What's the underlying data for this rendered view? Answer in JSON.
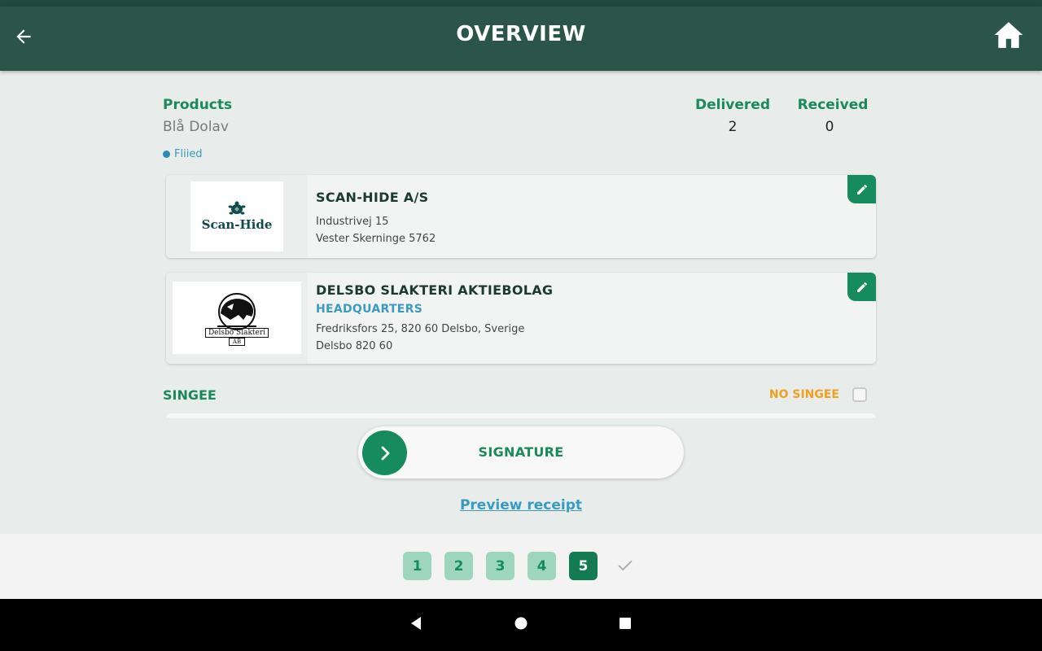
{
  "header": {
    "title": "OVERVIEW"
  },
  "summary": {
    "products_label": "Products",
    "products_value": "Blå Dolav",
    "status_label": "Fliied",
    "delivered_label": "Delivered",
    "delivered_value": "2",
    "received_label": "Received",
    "received_value": "0"
  },
  "cards": [
    {
      "logo_text": "Scan-Hide",
      "name": "SCAN-HIDE A/S",
      "address_line1": "Industrivej 15",
      "address_line2": "Vester Skerninge 5762"
    },
    {
      "logo_text": "Delsbo Slakteri",
      "logo_subtext": "AB",
      "name": "DELSBO SLAKTERI AKTIEBOLAG",
      "subtitle": "HEADQUARTERS",
      "address_line1": "Fredriksfors 25, 820 60 Delsbo, Sverige",
      "address_line2": "Delsbo 820 60"
    }
  ],
  "singee": {
    "label": "SINGEE",
    "no_singee_label": "NO SINGEE",
    "no_singee_checked": false
  },
  "signature": {
    "label": "SIGNATURE"
  },
  "preview_link": "Preview receipt",
  "steps": {
    "items": [
      "1",
      "2",
      "3",
      "4",
      "5"
    ],
    "active": "5"
  },
  "colors": {
    "header": "#2a5548",
    "accent": "#158b5e",
    "link": "#3a9ac0",
    "warning": "#f0a020"
  }
}
